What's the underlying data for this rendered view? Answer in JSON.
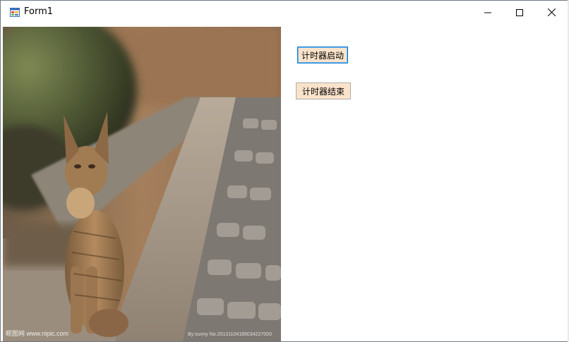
{
  "window": {
    "title": "Form1",
    "controls": {
      "minimize_icon": "minimize-icon",
      "maximize_icon": "maximize-icon",
      "close_icon": "close-icon"
    }
  },
  "content": {
    "picture": {
      "subject": "cat-photo",
      "watermark_left": "昵图网 www.nipic.com",
      "watermark_right": "By:sunny No.20131104185034227000"
    },
    "buttons": {
      "start_label": "计时器启动",
      "stop_label": "计时器结束"
    }
  },
  "colors": {
    "button_face": "#fbe3cb",
    "button_border": "#adadad",
    "focus_border": "#0078d7",
    "window_border": "#6f7a86"
  }
}
